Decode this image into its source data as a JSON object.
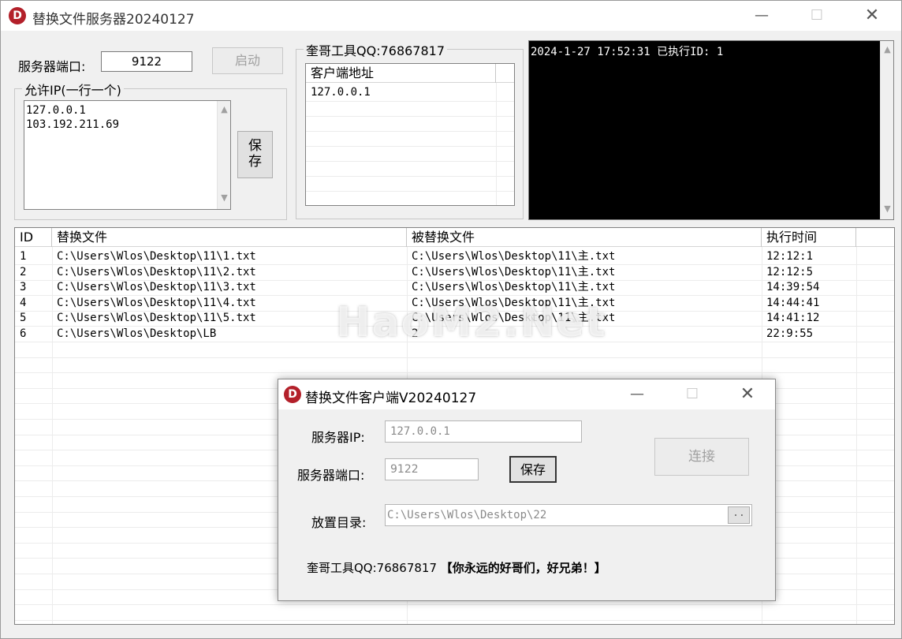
{
  "server_window": {
    "title": "替换文件服务器20240127",
    "port_label": "服务器端口:",
    "port_value": "9122",
    "start_label": "启动",
    "allowed_ip_caption": "允许IP(一行一个)",
    "allowed_ips": [
      "127.0.0.1",
      "103.192.211.69"
    ],
    "save_label": "保\n存",
    "save_label_line1": "保",
    "save_label_line2": "存",
    "clients_caption": "奎哥工具QQ:76867817",
    "clients_header": "客户端地址",
    "clients": [
      "127.0.0.1"
    ],
    "log_line": "2024-1-27 17:52:31 已执行ID: 1",
    "table": {
      "headers": [
        "ID",
        "替换文件",
        "被替换文件",
        "执行时间"
      ],
      "rows": [
        [
          "1",
          "C:\\Users\\Wlos\\Desktop\\11\\1.txt",
          "C:\\Users\\Wlos\\Desktop\\11\\主.txt",
          "12:12:1"
        ],
        [
          "2",
          "C:\\Users\\Wlos\\Desktop\\11\\2.txt",
          "C:\\Users\\Wlos\\Desktop\\11\\主.txt",
          "12:12:5"
        ],
        [
          "3",
          "C:\\Users\\Wlos\\Desktop\\11\\3.txt",
          "C:\\Users\\Wlos\\Desktop\\11\\主.txt",
          "14:39:54"
        ],
        [
          "4",
          "C:\\Users\\Wlos\\Desktop\\11\\4.txt",
          "C:\\Users\\Wlos\\Desktop\\11\\主.txt",
          "14:44:41"
        ],
        [
          "5",
          "C:\\Users\\Wlos\\Desktop\\11\\5.txt",
          "C:\\Users\\Wlos\\Desktop\\11\\主.txt",
          "14:41:12"
        ],
        [
          "6",
          "C:\\Users\\Wlos\\Desktop\\LB",
          "2",
          "22:9:55"
        ]
      ]
    }
  },
  "client_window": {
    "title": "替换文件客户端V20240127",
    "server_ip_label": "服务器IP:",
    "server_ip_value": "127.0.0.1",
    "port_label": "服务器端口:",
    "port_value": "9122",
    "save_label": "保存",
    "connect_label": "连接",
    "dir_label": "放置目录:",
    "dir_value": "C:\\Users\\Wlos\\Desktop\\22",
    "browse_label": "..",
    "footer_prefix": "奎哥工具QQ:76867817",
    "footer_slogan": "【你永远的好哥们，好兄弟！】"
  },
  "watermark": "HaoM2.Net",
  "colors": {
    "logo": "#b3202a",
    "log_bg": "#000000",
    "log_text": "#ffffff"
  },
  "icons": {
    "minimize": "minimize-icon",
    "maximize": "maximize-icon",
    "close": "close-icon"
  }
}
